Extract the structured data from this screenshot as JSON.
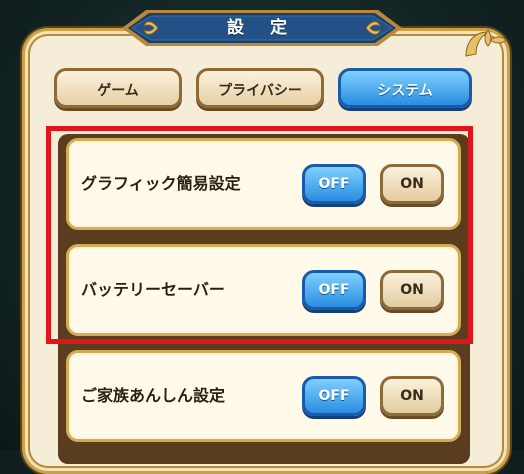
{
  "header": {
    "title": "設 定"
  },
  "tabs": [
    {
      "label": "ゲーム",
      "active": false
    },
    {
      "label": "プライバシー",
      "active": false
    },
    {
      "label": "システム",
      "active": true
    }
  ],
  "settings": [
    {
      "label": "グラフィック簡易設定",
      "off_label": "OFF",
      "on_label": "ON",
      "selected": "OFF"
    },
    {
      "label": "バッテリーセーバー",
      "off_label": "OFF",
      "on_label": "ON",
      "selected": "OFF"
    },
    {
      "label": "ご家族あんしん設定",
      "off_label": "OFF",
      "on_label": "ON",
      "selected": "OFF"
    }
  ],
  "colors": {
    "active_blue": "#2a8de0",
    "panel_cream": "#f6edd8",
    "highlight_red": "#e3141a"
  }
}
